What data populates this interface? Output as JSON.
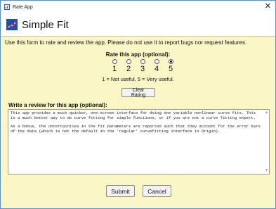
{
  "window": {
    "title": "Rate App",
    "close_glyph": "✕"
  },
  "header": {
    "app_name": "Simple Fit",
    "logo_icon": "chart-logo-icon"
  },
  "intro_text": "Use this form to rate and review the app. Please do not use it to report bugs nor request features.",
  "rating": {
    "label": "Rate this app (optional):",
    "options": [
      "1",
      "2",
      "3",
      "4",
      "5"
    ],
    "selected": "5",
    "scale_text": "1 = Not useful, 5 = Very useful.",
    "clear_label": "Clear Rating"
  },
  "review": {
    "label": "Write a review for this app (optional):",
    "paragraph1": "This app provides a much quicker, one-screen interface for doing one variable nonlinear curve fits. This is a much better way to do curve fitting for simple functions, or if you are not a curve fitting expert.",
    "paragraph2": "As a bonus, the uncertainties in the fit parameters are reported such that they account for the error bars of the data (which is not the default in the 'regular' curvefitting interface in Origin)."
  },
  "buttons": {
    "submit": "Submit",
    "cancel": "Cancel"
  }
}
